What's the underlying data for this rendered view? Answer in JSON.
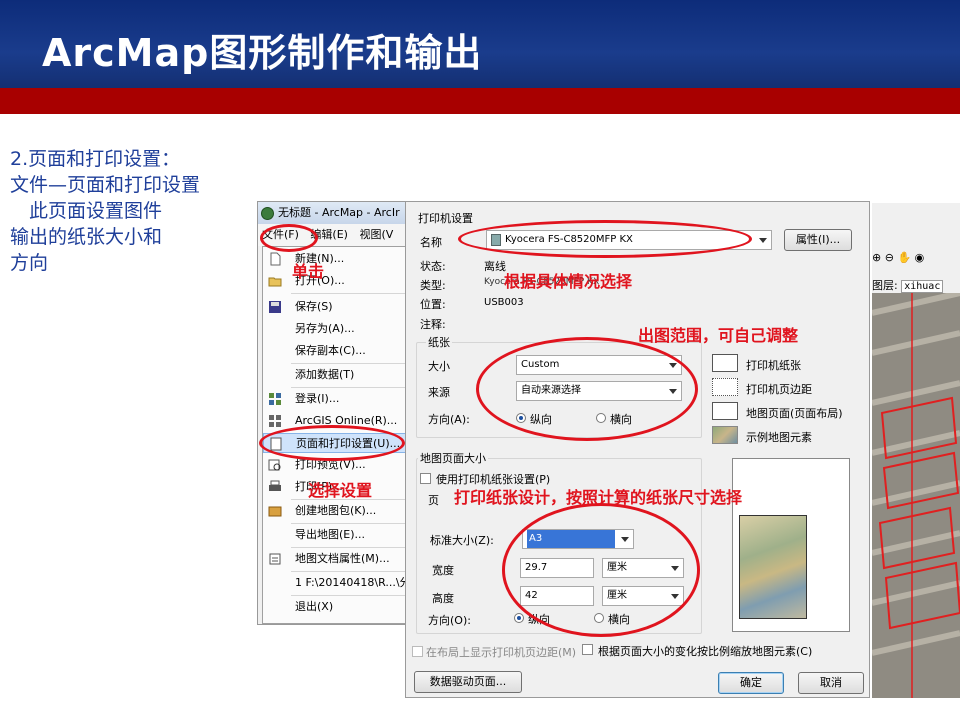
{
  "slide": {
    "title": "ArcMap图形制作和输出",
    "left_lines": [
      "2.页面和打印设置：",
      "文件—页面和打印设置",
      "　此页面设置图件",
      "输出的纸张大小和",
      "方向"
    ]
  },
  "window": {
    "title": "无标题 - ArcMap - ArcIr",
    "menubar": [
      "文件(F)",
      "编辑(E)",
      "视图(V"
    ]
  },
  "file_menu": {
    "items": [
      "新建(N)...",
      "打开(O)...",
      "保存(S)",
      "另存为(A)...",
      "保存副本(C)...",
      "添加数据(T)",
      "登录(I)...",
      "ArcGIS Online(R)...",
      "页面和打印设置(U)...",
      "打印预览(V)...",
      "打印(P)...",
      "创建地图包(K)...",
      "导出地图(E)...",
      "地图文档属性(M)...",
      "1 F:\\20140418\\R...\\分",
      "退出(X)"
    ]
  },
  "dialog": {
    "printer_group": "打印机设置",
    "name_label": "名称",
    "printer_name": "Kyocera FS-C8520MFP KX",
    "properties_button": "属性(I)...",
    "status_label": "状态:",
    "status_value": "离线",
    "type_label": "类型:",
    "type_value": "Kyocera FS-C8520MFP KX",
    "location_label": "位置:",
    "location_value": "USB003",
    "comment_label": "注释:",
    "paper_group": "纸张",
    "size_label": "大小",
    "size_value": "Custom",
    "source_label": "来源",
    "source_value": "自动来源选择",
    "orientation_label": "方向(A):",
    "portrait": "纵向",
    "landscape": "横向",
    "legend": [
      "打印机纸张",
      "打印机页边距",
      "地图页面(页面布局)",
      "示例地图元素"
    ],
    "mapsize_group": "地图页面大小",
    "use_printer_settings": "使用打印机纸张设置(P)",
    "page_label": "页",
    "standard_size_label": "标准大小(Z):",
    "standard_size_value": "A3",
    "width_label": "宽度",
    "width_value": "29.7",
    "width_unit": "厘米",
    "height_label": "高度",
    "height_value": "42",
    "height_unit": "厘米",
    "orientation2_label": "方向(O):",
    "show_margins": "在布局上显示打印机页边距(M)",
    "scale_elements": "根据页面大小的变化按比例缩放地图元素(C)",
    "ddp_button": "数据驱动页面...",
    "ok_button": "确定",
    "cancel_button": "取消"
  },
  "annotations": {
    "click": "单击",
    "select_setting": "选择设置",
    "choose_by_situation": "根据具体情况选择",
    "extent": "出图范围，可自己调整",
    "paper_design": "打印纸张设计，按照计算的纸张尺寸选择"
  },
  "map_side": {
    "layer_label": "图层:",
    "layer_value": "xihuac"
  },
  "colors": {
    "header": "#1a3c8c",
    "redbar": "#a80000",
    "annotation": "#e0141e",
    "left_text": "#1f3f9a"
  }
}
